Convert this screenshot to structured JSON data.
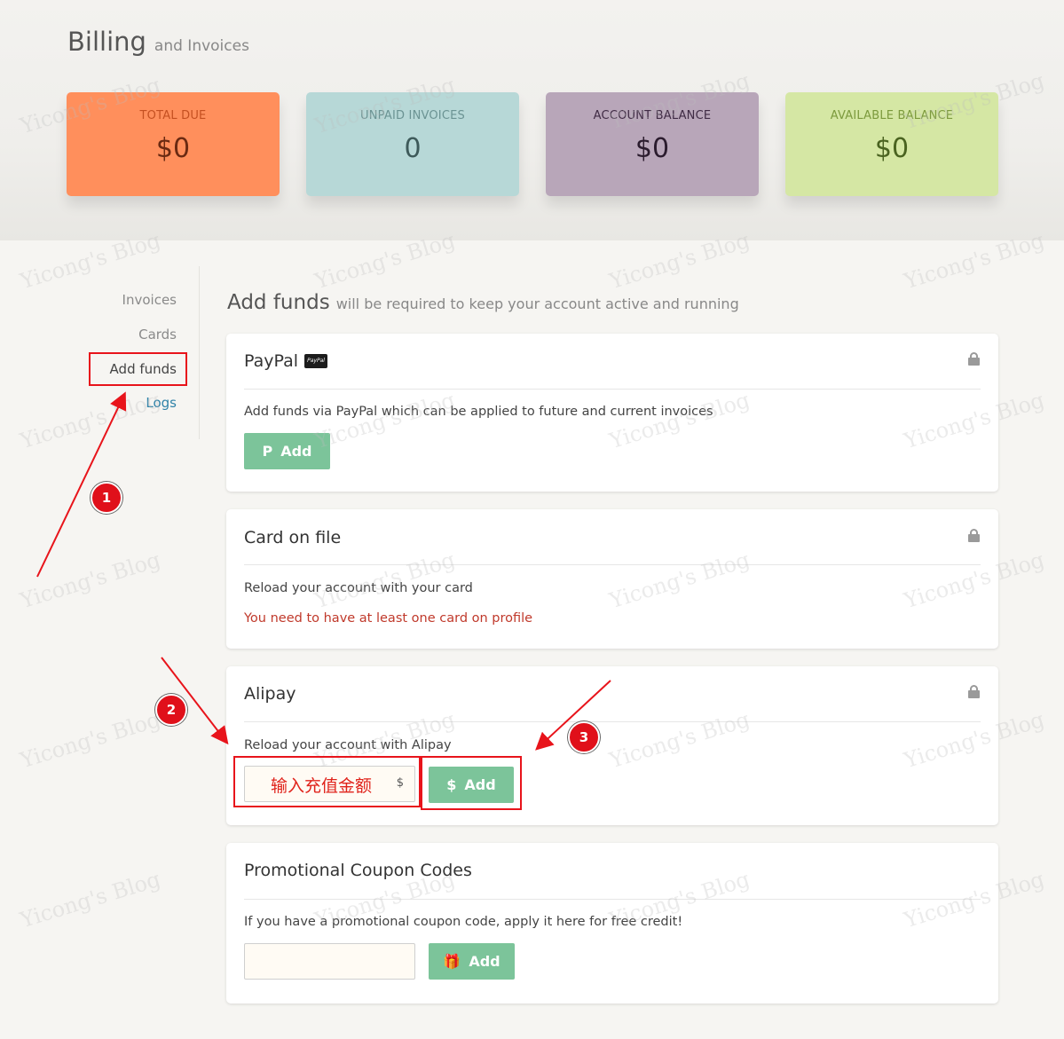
{
  "header": {
    "title": "Billing",
    "subtitle": "and Invoices"
  },
  "stats": [
    {
      "label": "TOTAL DUE",
      "value": "$0"
    },
    {
      "label": "UNPAID INVOICES",
      "value": "0"
    },
    {
      "label": "ACCOUNT BALANCE",
      "value": "$0"
    },
    {
      "label": "AVAILABLE BALANCE",
      "value": "$0"
    }
  ],
  "sidebar": {
    "items": [
      {
        "label": "Invoices"
      },
      {
        "label": "Cards"
      },
      {
        "label": "Add funds"
      },
      {
        "label": "Logs"
      }
    ]
  },
  "section": {
    "title": "Add funds",
    "subtitle": "will be required to keep your account active and running"
  },
  "paypal": {
    "title": "PayPal",
    "badge": "PayPal",
    "description": "Add funds via PayPal which can be applied to future and current invoices",
    "button_label": "Add",
    "button_icon": "P"
  },
  "card_on_file": {
    "title": "Card on file",
    "description": "Reload your account with your card",
    "warning": "You need to have at least one card on profile"
  },
  "alipay": {
    "title": "Alipay",
    "description": "Reload your account with Alipay",
    "input_value": "输入充值金额",
    "input_suffix": "$",
    "button_label": "Add",
    "button_icon": "$"
  },
  "coupon": {
    "title": "Promotional Coupon Codes",
    "description": "If you have a promotional coupon code, apply it here for free credit!",
    "input_value": "",
    "button_label": "Add",
    "button_icon": "🎁"
  },
  "annotations": {
    "badges": [
      "1",
      "2",
      "3"
    ],
    "color": "#e0101a"
  },
  "watermark": "Yicong's Blog",
  "colors": {
    "accent_button": "#7cc49a",
    "link": "#2f82a8",
    "warning": "#c0392b"
  }
}
